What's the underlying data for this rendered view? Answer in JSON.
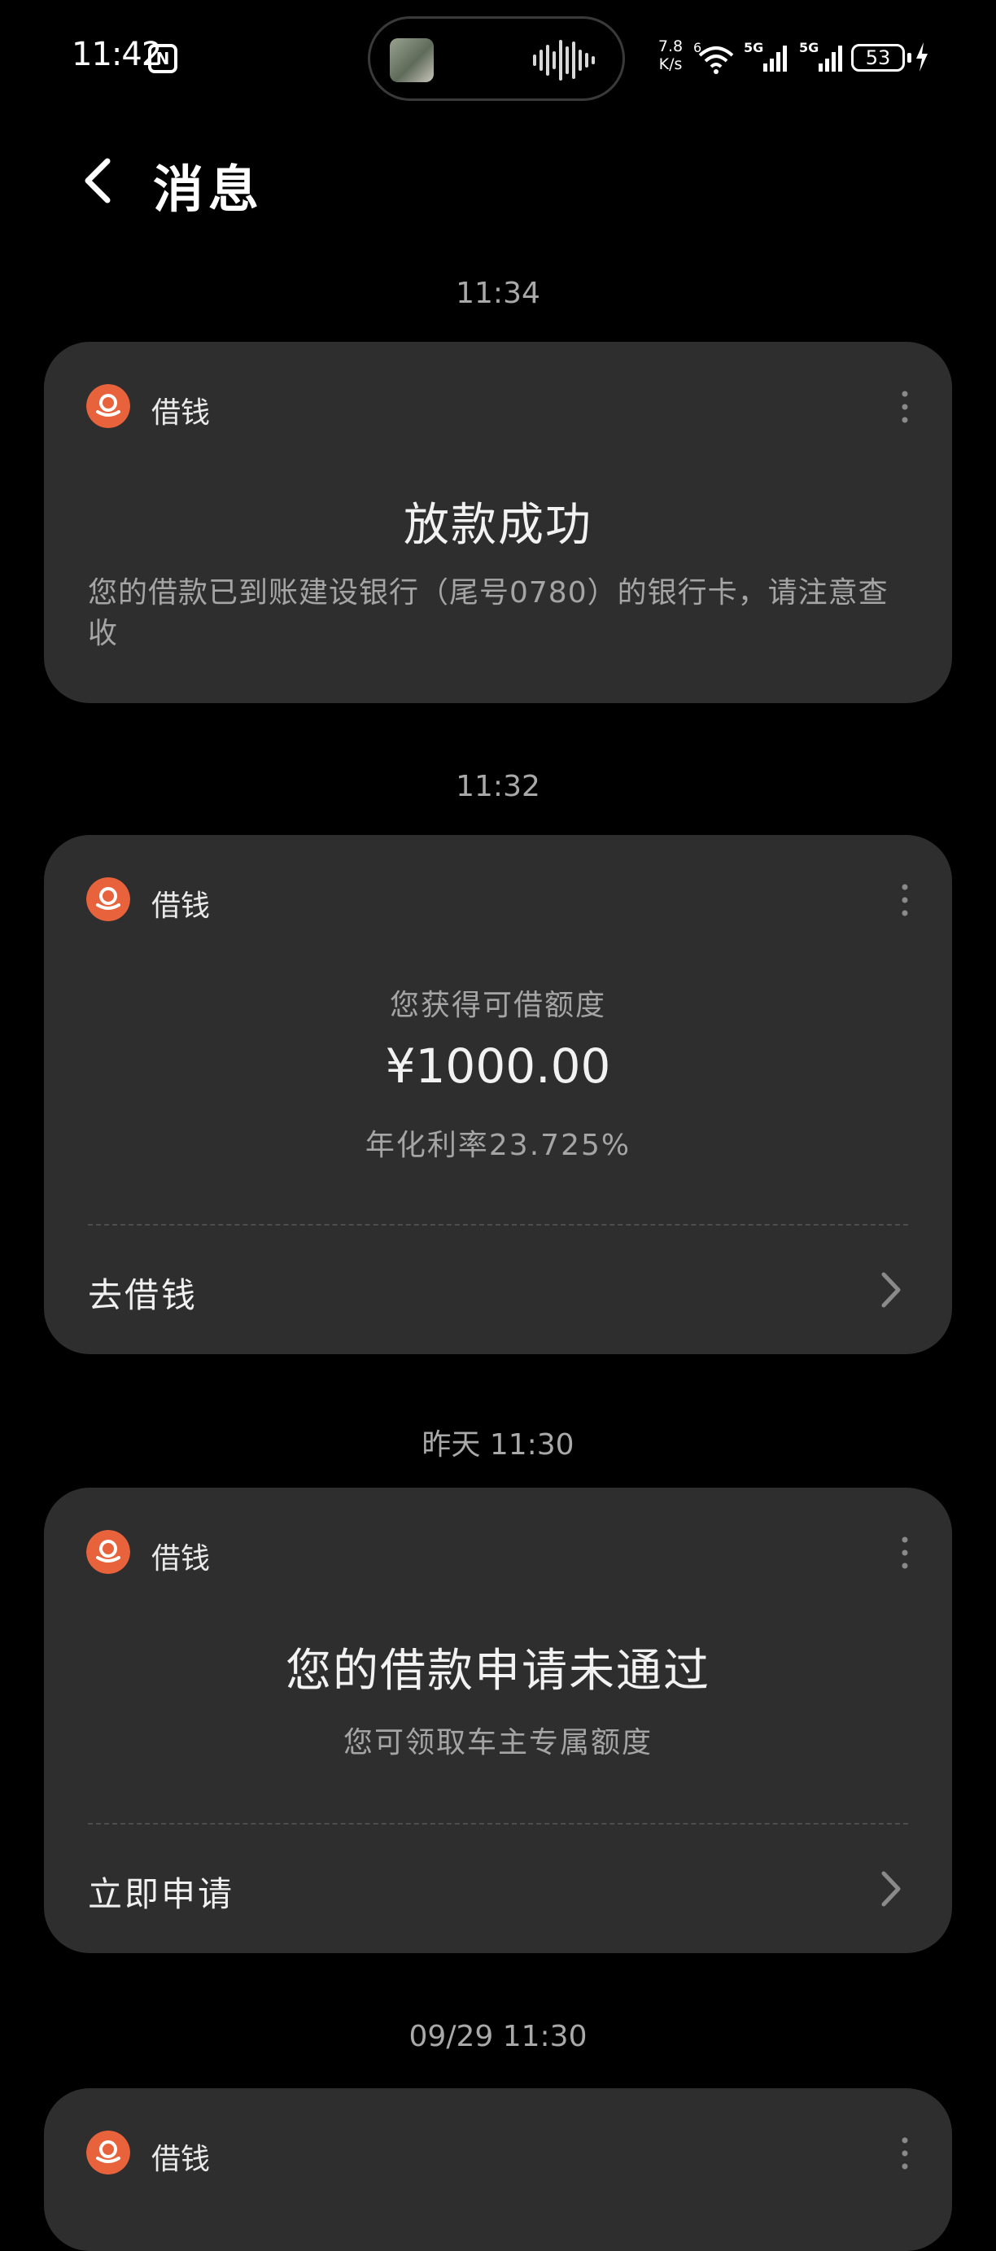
{
  "status_bar": {
    "time": "11:42",
    "nfc_icon": "nfc-icon",
    "network_speed_value": "7.8",
    "network_speed_unit": "K/s",
    "wifi_label": "6",
    "sim1_label": "5G",
    "sim2_label": "5G",
    "battery": "53"
  },
  "header": {
    "back_icon": "chevron-left-icon",
    "title": "消息"
  },
  "messages": [
    {
      "timestamp": "11:34",
      "app_name": "借钱",
      "title": "放款成功",
      "body": "您的借款已到账建设银行（尾号0780）的银行卡，请注意查收"
    },
    {
      "timestamp": "11:32",
      "app_name": "借钱",
      "subtitle": "您获得可借额度",
      "amount": "¥1000.00",
      "rate": "年化利率23.725%",
      "action": "去借钱"
    },
    {
      "timestamp": "昨天 11:30",
      "app_name": "借钱",
      "title": "您的借款申请未通过",
      "subtitle": "您可领取车主专属额度",
      "action": "立即申请"
    },
    {
      "timestamp": "09/29 11:30",
      "app_name": "借钱"
    }
  ],
  "colors": {
    "background": "#000000",
    "card": "#2e2e2e",
    "accent": "#e8623c",
    "muted_text": "#a5a5a5"
  }
}
